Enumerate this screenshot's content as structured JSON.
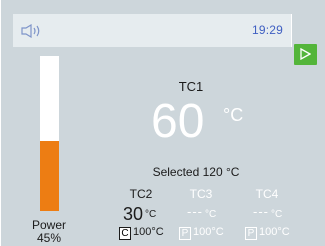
{
  "status_bar": {
    "time": "19:29",
    "icons": {
      "speaker": "speaker-icon",
      "play": "play-icon"
    }
  },
  "power": {
    "label": "Power",
    "value_text": "45%",
    "fraction": 0.45
  },
  "tc1": {
    "label": "TC1",
    "value": "60",
    "unit": "°C",
    "selected": "Selected 120 °C"
  },
  "channels": [
    {
      "name": "TC2",
      "value": "30",
      "unit": "°C",
      "mode": "C",
      "setpoint": "100°C"
    },
    {
      "name": "TC3",
      "value": "---",
      "unit": "°C",
      "mode": "P",
      "setpoint": "100°C"
    },
    {
      "name": "TC4",
      "value": "---",
      "unit": "°C",
      "mode": "P",
      "setpoint": "100°C"
    }
  ],
  "colors": {
    "background": "#cdd6db",
    "power_fill": "#ed7d13",
    "time_text": "#3f5fc2",
    "play_button": "#53b53a"
  }
}
